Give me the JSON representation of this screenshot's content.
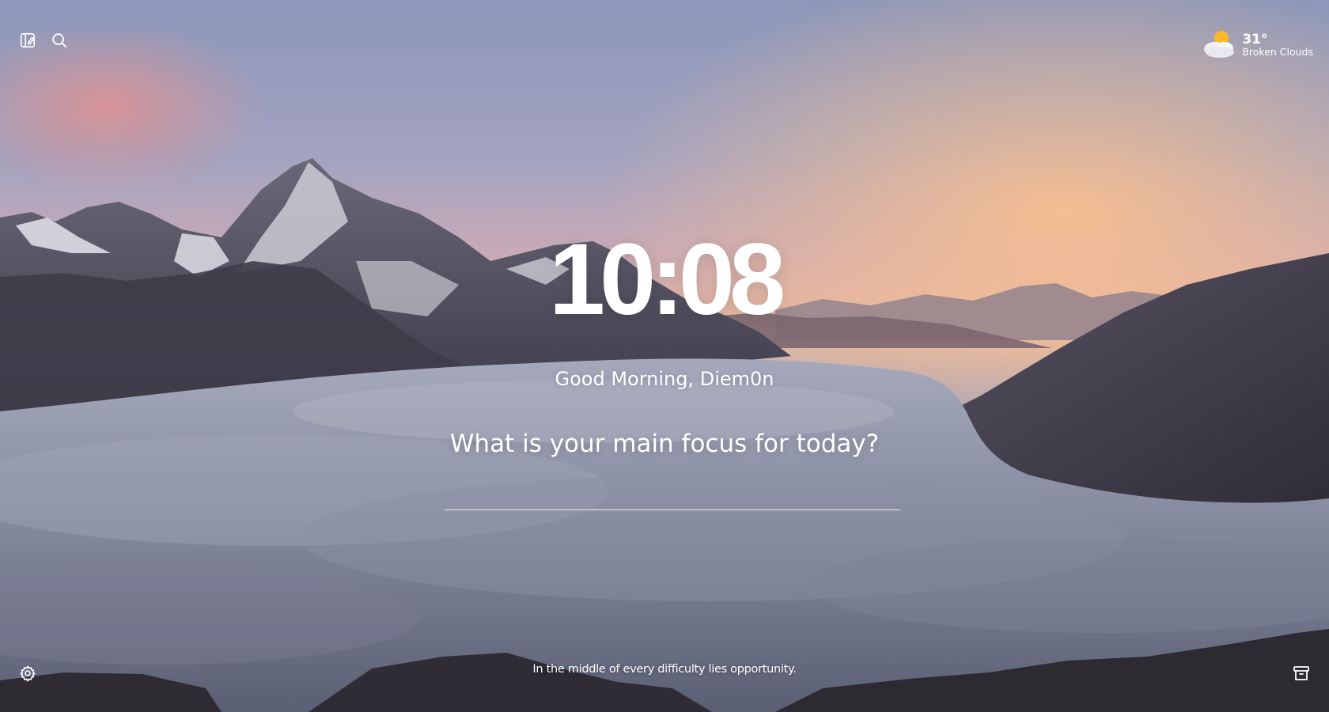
{
  "topbar": {
    "left_icons": [
      "customize-panel-icon",
      "search-icon"
    ]
  },
  "weather": {
    "temperature": "31°",
    "description": "Broken Clouds",
    "icon": "partly-cloudy-icon"
  },
  "clock": {
    "time": "10:08"
  },
  "greeting": {
    "text": "Good Morning, Diem0n"
  },
  "focus": {
    "question": "What is your main focus for today?",
    "value": ""
  },
  "quote": {
    "text": "In the middle of every difficulty lies opportunity."
  },
  "footer": {
    "left_icon": "settings-icon",
    "right_icon": "archive-icon"
  },
  "theme": {
    "text_color": "#ffffff",
    "sky_top": "#8e98b8",
    "sunset_glow": "#f2b28a"
  }
}
